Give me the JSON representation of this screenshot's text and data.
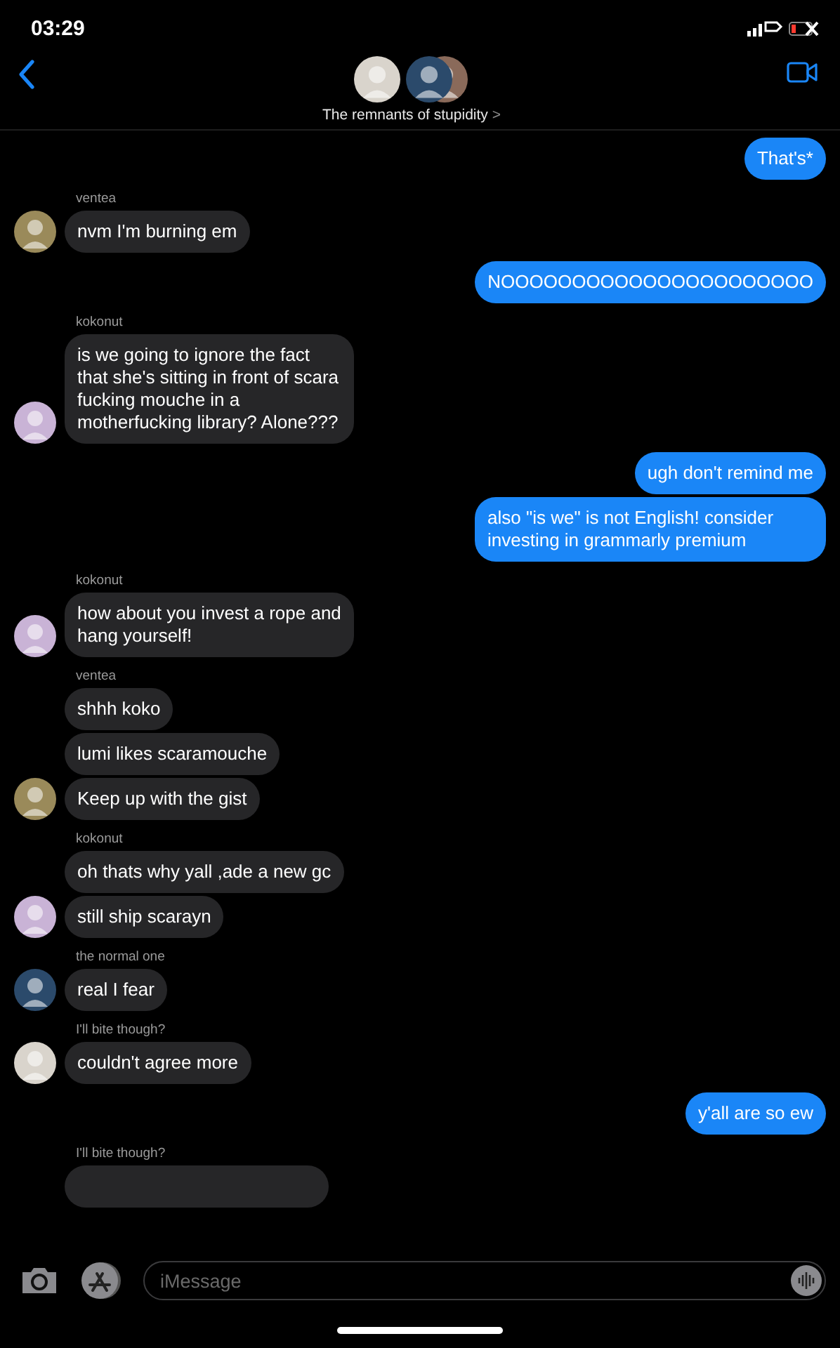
{
  "status_bar": {
    "time": "03:29"
  },
  "header": {
    "title": "The remnants of stupidity",
    "chevron": ">",
    "avatars": [
      {
        "color": "#d9d4cc"
      },
      {
        "color": "#2b4a6b"
      },
      {
        "color": "#8a6a5a"
      }
    ]
  },
  "messages": [
    {
      "kind": "sent",
      "text": "That's*"
    },
    {
      "kind": "received",
      "sender": "ventea",
      "avatar": {
        "color": "#9a8a5a"
      },
      "text": "nvm I'm burning em"
    },
    {
      "kind": "sent",
      "text": "NOOOOOOOOOOOOOOOOOOOOOO"
    },
    {
      "kind": "received",
      "sender": "kokonut",
      "avatar": {
        "color": "#c9b3d6"
      },
      "text": "is we going to ignore the fact that she's sitting in front of scara fucking mouche in a motherfucking library? Alone???"
    },
    {
      "kind": "sent",
      "text": "ugh don't remind me"
    },
    {
      "kind": "sent",
      "text": "also \"is we\" is not English! consider investing in grammarly premium"
    },
    {
      "kind": "received",
      "sender": "kokonut",
      "avatar": {
        "color": "#c9b3d6"
      },
      "text": "how about you invest a rope and hang yourself!"
    },
    {
      "kind": "received",
      "sender": "ventea",
      "text": "shhh koko"
    },
    {
      "kind": "received",
      "text": "lumi likes scaramouche"
    },
    {
      "kind": "received",
      "avatar": {
        "color": "#9a8a5a"
      },
      "text": "Keep up with the gist"
    },
    {
      "kind": "received",
      "sender": "kokonut",
      "text": "oh thats why yall ,ade a new gc"
    },
    {
      "kind": "received",
      "avatar": {
        "color": "#c9b3d6"
      },
      "text": "still ship scarayn"
    },
    {
      "kind": "received",
      "sender": "the normal one",
      "avatar": {
        "color": "#2b4a6b"
      },
      "text": "real I fear"
    },
    {
      "kind": "received",
      "sender": "I'll bite though?",
      "avatar": {
        "color": "#d9d4cc"
      },
      "text": "couldn't agree more"
    },
    {
      "kind": "sent",
      "text": "y'all are so ew"
    },
    {
      "kind": "partial",
      "sender": "I'll bite though?"
    }
  ],
  "composer": {
    "placeholder": "iMessage"
  }
}
